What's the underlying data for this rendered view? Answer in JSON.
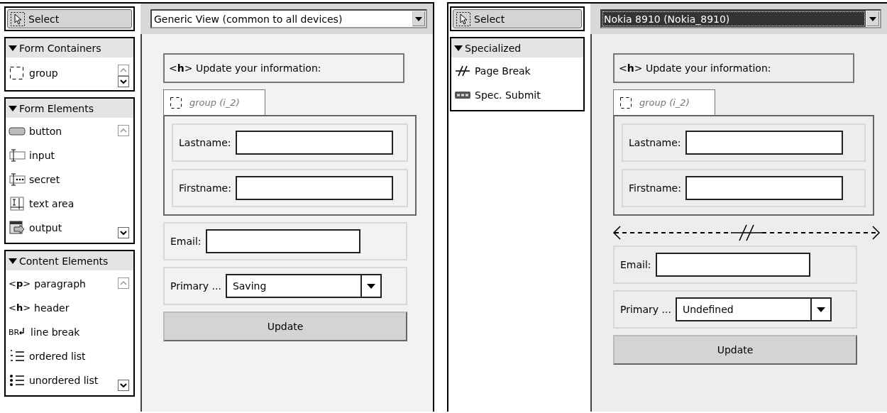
{
  "panels": [
    {
      "select_tool": "Select",
      "device": {
        "value": "Generic View (common to all devices)",
        "focused": false
      },
      "palette": [
        {
          "title": "Form Containers",
          "expanded": true,
          "scrollable": true,
          "items": [
            {
              "label": "group",
              "kind": "group"
            }
          ]
        },
        {
          "title": "Form Elements",
          "expanded": true,
          "scrollable": true,
          "items": [
            {
              "label": "button",
              "kind": "button"
            },
            {
              "label": "input",
              "kind": "input"
            },
            {
              "label": "secret",
              "kind": "secret"
            },
            {
              "label": "text area",
              "kind": "textarea"
            },
            {
              "label": "output",
              "kind": "output"
            }
          ]
        },
        {
          "title": "Content Elements",
          "expanded": true,
          "scrollable": true,
          "items": [
            {
              "label": "paragraph",
              "kind": "tag",
              "tag": "<**p**>"
            },
            {
              "label": "header",
              "kind": "tag",
              "tag": "<**h**>"
            },
            {
              "label": "line break",
              "kind": "br",
              "tag": "BR"
            },
            {
              "label": "ordered list",
              "kind": "ol"
            },
            {
              "label": "unordered list",
              "kind": "ul"
            }
          ]
        }
      ],
      "form": [
        {
          "kind": "heading",
          "tag": "<**h**>",
          "text": "Update your information:"
        },
        {
          "kind": "group",
          "label": "group (i_2)",
          "children": [
            {
              "kind": "text_field",
              "label": "Lastname:"
            },
            {
              "kind": "text_field",
              "label": "Firstname:"
            }
          ]
        },
        {
          "kind": "text_field",
          "label": "Email:"
        },
        {
          "kind": "select",
          "label": "Primary ...",
          "value": "Saving"
        },
        {
          "kind": "button",
          "label": "Update"
        }
      ]
    },
    {
      "select_tool": "Select",
      "device": {
        "value": "Nokia 8910 (Nokia_8910)",
        "focused": true
      },
      "palette": [
        {
          "title": "Specialized",
          "expanded": true,
          "scrollable": false,
          "items": [
            {
              "label": "Page Break",
              "kind": "pagebreak"
            },
            {
              "label": "Spec. Submit",
              "kind": "submit"
            }
          ]
        }
      ],
      "form": [
        {
          "kind": "heading",
          "tag": "<**h**>",
          "text": "Update your information:"
        },
        {
          "kind": "group",
          "label": "group (i_2)",
          "children": [
            {
              "kind": "text_field",
              "label": "Lastname:"
            },
            {
              "kind": "text_field",
              "label": "Firstname:"
            }
          ]
        },
        {
          "kind": "page_break"
        },
        {
          "kind": "text_field",
          "label": "Email:"
        },
        {
          "kind": "select",
          "label": "Primary ...",
          "value": "Undefined"
        },
        {
          "kind": "button",
          "label": "Update"
        }
      ]
    }
  ]
}
